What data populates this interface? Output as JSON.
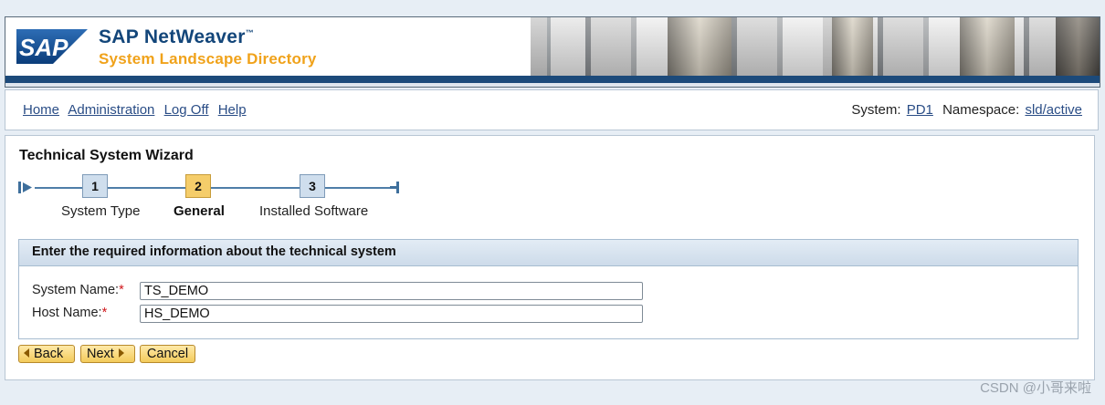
{
  "header": {
    "brand_logo": "SAP",
    "product_title": "SAP NetWeaver",
    "trademark": "™",
    "subtitle": "System Landscape Directory"
  },
  "nav": {
    "links": [
      "Home",
      "Administration",
      "Log Off",
      "Help"
    ],
    "system_label": "System:",
    "system_value": "PD1",
    "namespace_label": "Namespace:",
    "namespace_value": "sld/active"
  },
  "wizard": {
    "title": "Technical System Wizard",
    "steps": [
      {
        "number": "1",
        "label": "System Type"
      },
      {
        "number": "2",
        "label": "General"
      },
      {
        "number": "3",
        "label": "Installed Software"
      }
    ],
    "active_step": 2
  },
  "form": {
    "heading": "Enter the required information about the technical system",
    "system_name_label": "System Name:",
    "system_name_value": "TS_DEMO",
    "host_name_label": "Host Name:",
    "host_name_value": "HS_DEMO",
    "required_marker": "*"
  },
  "buttons": {
    "back": "Back",
    "next": "Next",
    "cancel": "Cancel"
  },
  "watermark": "CSDN @小哥来啦",
  "colors": {
    "brand_blue": "#13467a",
    "brand_orange": "#f0a21a",
    "link": "#2a4d86",
    "required": "#d0161b",
    "active_step": "#f5cd6a"
  }
}
